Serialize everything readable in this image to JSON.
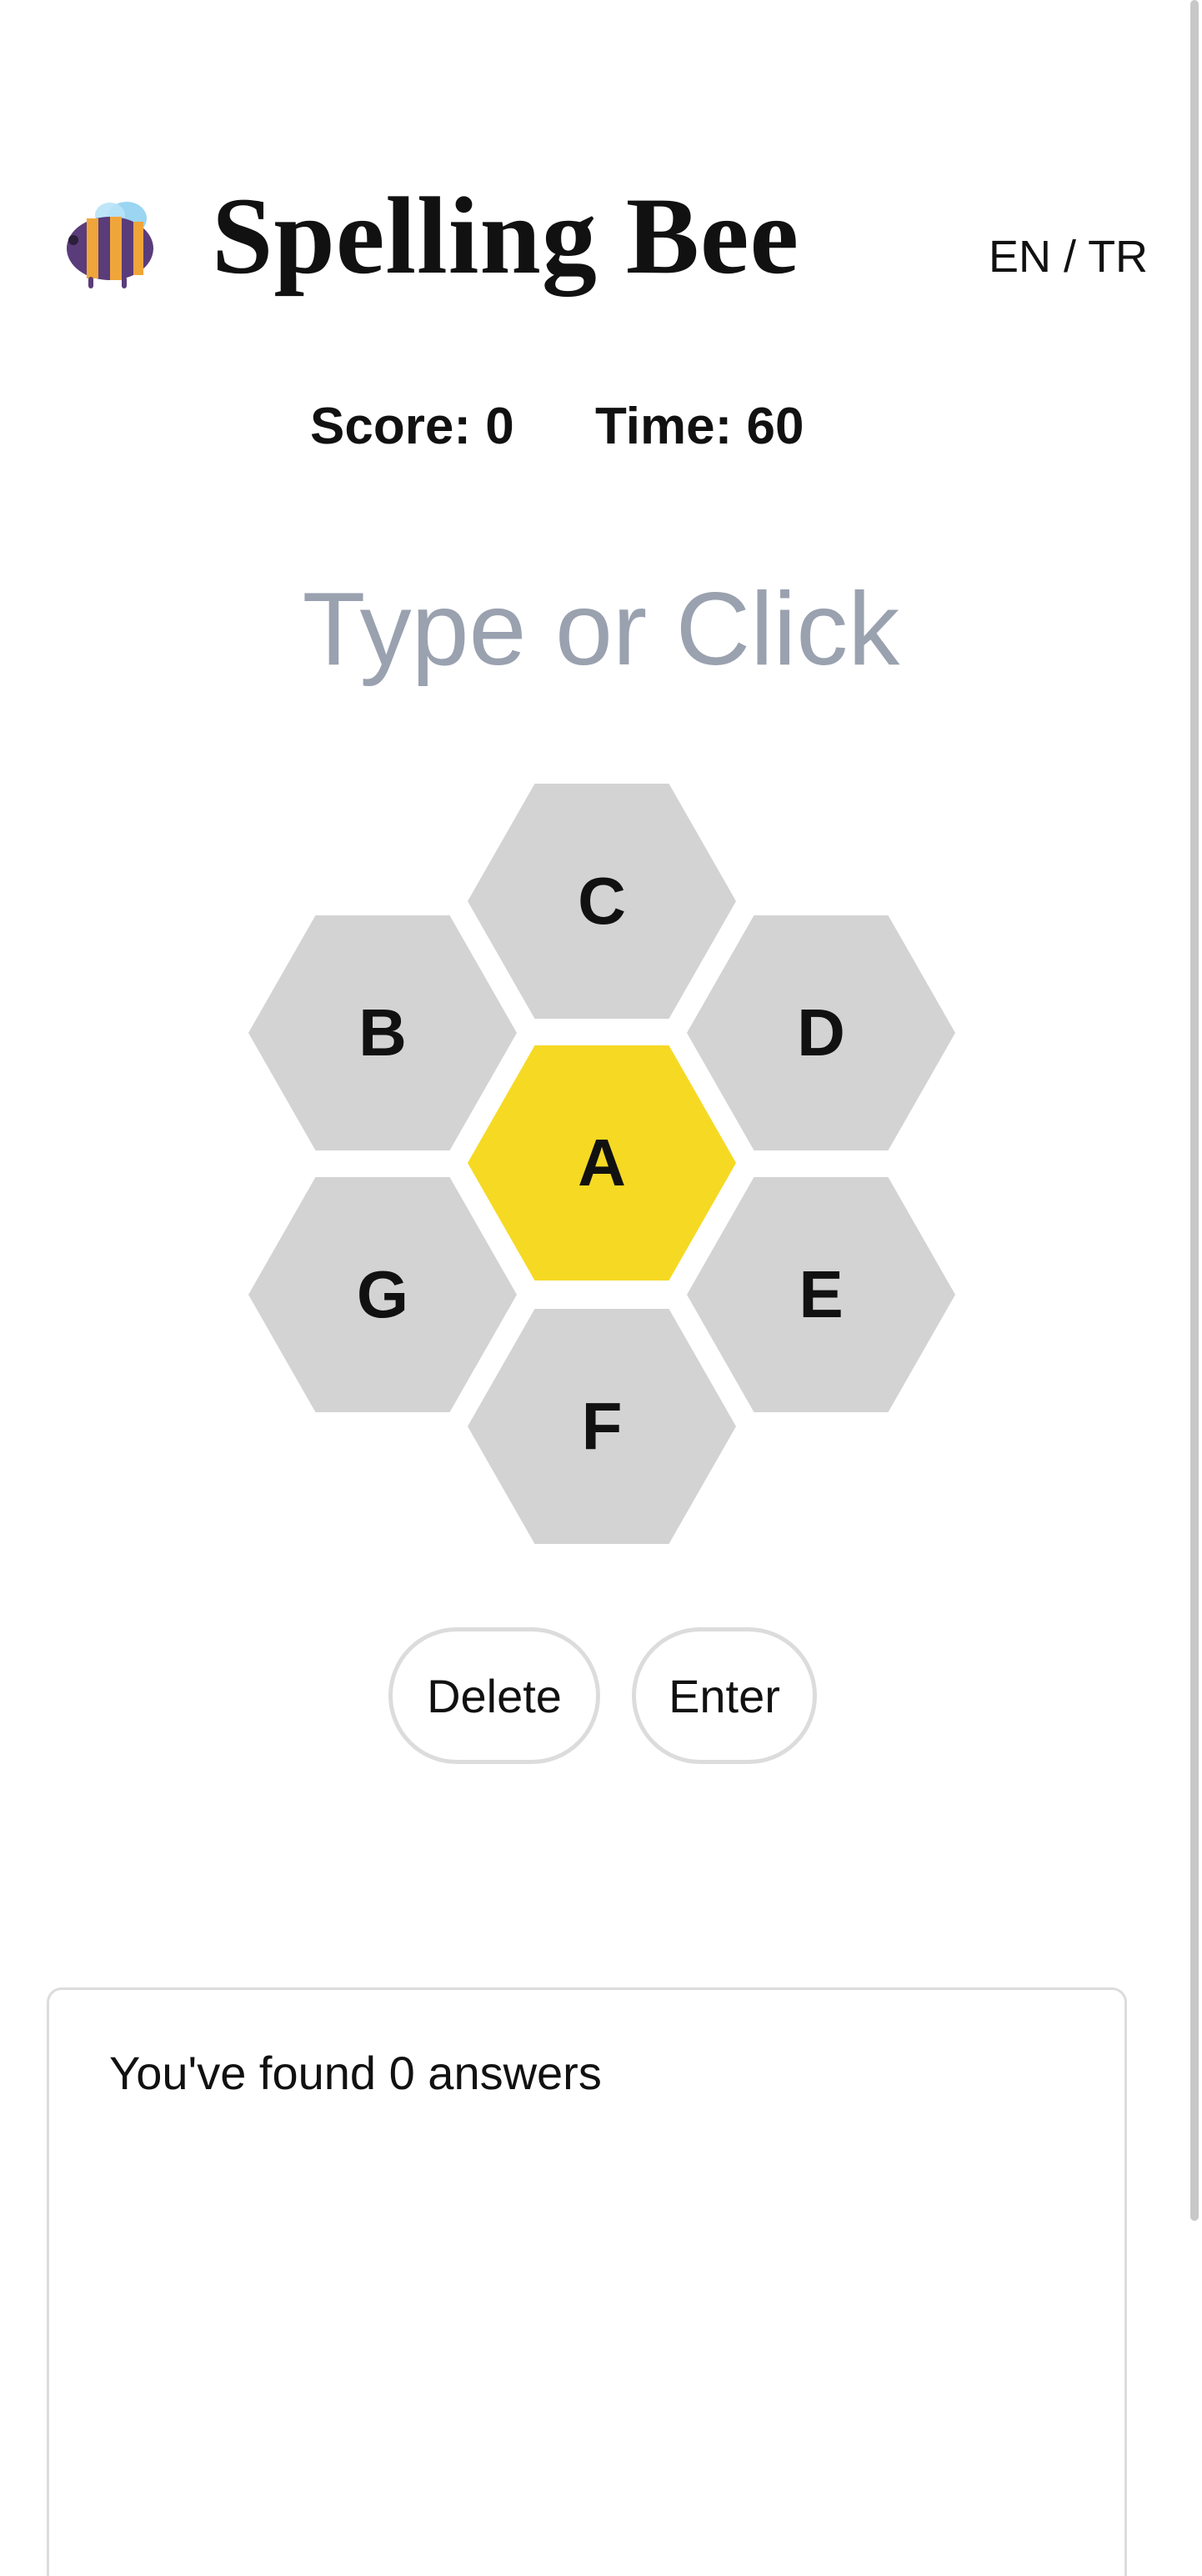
{
  "header": {
    "title": "Spelling Bee",
    "logo_icon": "bee-icon",
    "language": {
      "en": "EN",
      "separator": " / ",
      "tr": "TR"
    }
  },
  "stats": {
    "score": "Score: 0",
    "time": "Time: 60"
  },
  "input": {
    "placeholder": "Type or Click",
    "value": ""
  },
  "hive": {
    "center": "A",
    "outer": [
      "C",
      "B",
      "D",
      "G",
      "E",
      "F"
    ]
  },
  "actions": {
    "delete_label": "Delete",
    "enter_label": "Enter"
  },
  "answers": {
    "summary": "You've found 0 answers"
  },
  "colors": {
    "center_cell": "#f6d923",
    "outer_cell": "#d3d3d3",
    "placeholder_text": "#9aa1af",
    "button_border": "#dcdcdc"
  }
}
